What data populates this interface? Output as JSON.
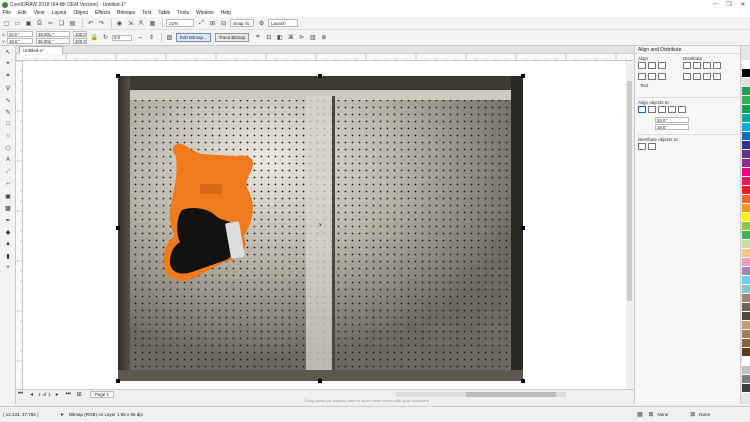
{
  "window": {
    "title": "CorelDRAW 2018 (64-Bit OEM Version) - Untitled-1*",
    "min": "–",
    "max": "❐",
    "close": "✕"
  },
  "menu": [
    "File",
    "Edit",
    "View",
    "Layout",
    "Object",
    "Effects",
    "Bitmaps",
    "Text",
    "Table",
    "Tools",
    "Window",
    "Help"
  ],
  "standard_toolbar": {
    "zoom": "22%",
    "snap_to": "Snap To",
    "launch": "Launch"
  },
  "property_bar": {
    "x": "24.0 \"",
    "y": "18.0 \"",
    "width": "48.001 \"",
    "height": "36.001 \"",
    "scale_x": "100.0",
    "scale_y": "100.0",
    "rotation": "0.0",
    "edit_bitmap": "Edit Bitmap...",
    "trace_bitmap": "Trace Bitmap"
  },
  "document_tab": "Untitled-1*",
  "page_nav": {
    "current": "1",
    "of_label": "of",
    "total": "1",
    "page_tab": "Page 1"
  },
  "hint": "Drag colors (or objects) here to store these colors with your document",
  "status": {
    "coords": "( 12.131, 37.765 )",
    "object_info": "Bitmap (RGB) on Layer 1 65 x 65 dpi",
    "fill": "None",
    "outline": "None"
  },
  "docker": {
    "title": "Align and Distribute",
    "align_label": "Align",
    "distribute_label": "Distribute",
    "text_label": "Text",
    "align_objects_to": "Align objects to:",
    "align_x": "24.0 \"",
    "align_y": "18.0 \"",
    "distribute_objects_to": "Distribute objects to:"
  },
  "palette": [
    "#ffffff",
    "#000000",
    "#e0e0e0",
    "#1fa34a",
    "#2fb34a",
    "#00a650",
    "#00a99d",
    "#00aeef",
    "#0072bc",
    "#2e3192",
    "#662d91",
    "#92278f",
    "#ec008c",
    "#ed145b",
    "#ed1c24",
    "#f26522",
    "#f7941d",
    "#fff200",
    "#8dc63f",
    "#39b54a",
    "#c4df9b",
    "#fdc689",
    "#f49ac1",
    "#a186be",
    "#6dcff6",
    "#7accc8",
    "#998675",
    "#736357",
    "#534741",
    "#c69c6d",
    "#a67c52",
    "#8c6239",
    "#603913",
    "#ffffff",
    "#c0c0c0",
    "#808080",
    "#404040"
  ],
  "colors": {
    "guitar": "#f07a1e",
    "pickguard": "#111111",
    "accent": "#1e64c8"
  }
}
